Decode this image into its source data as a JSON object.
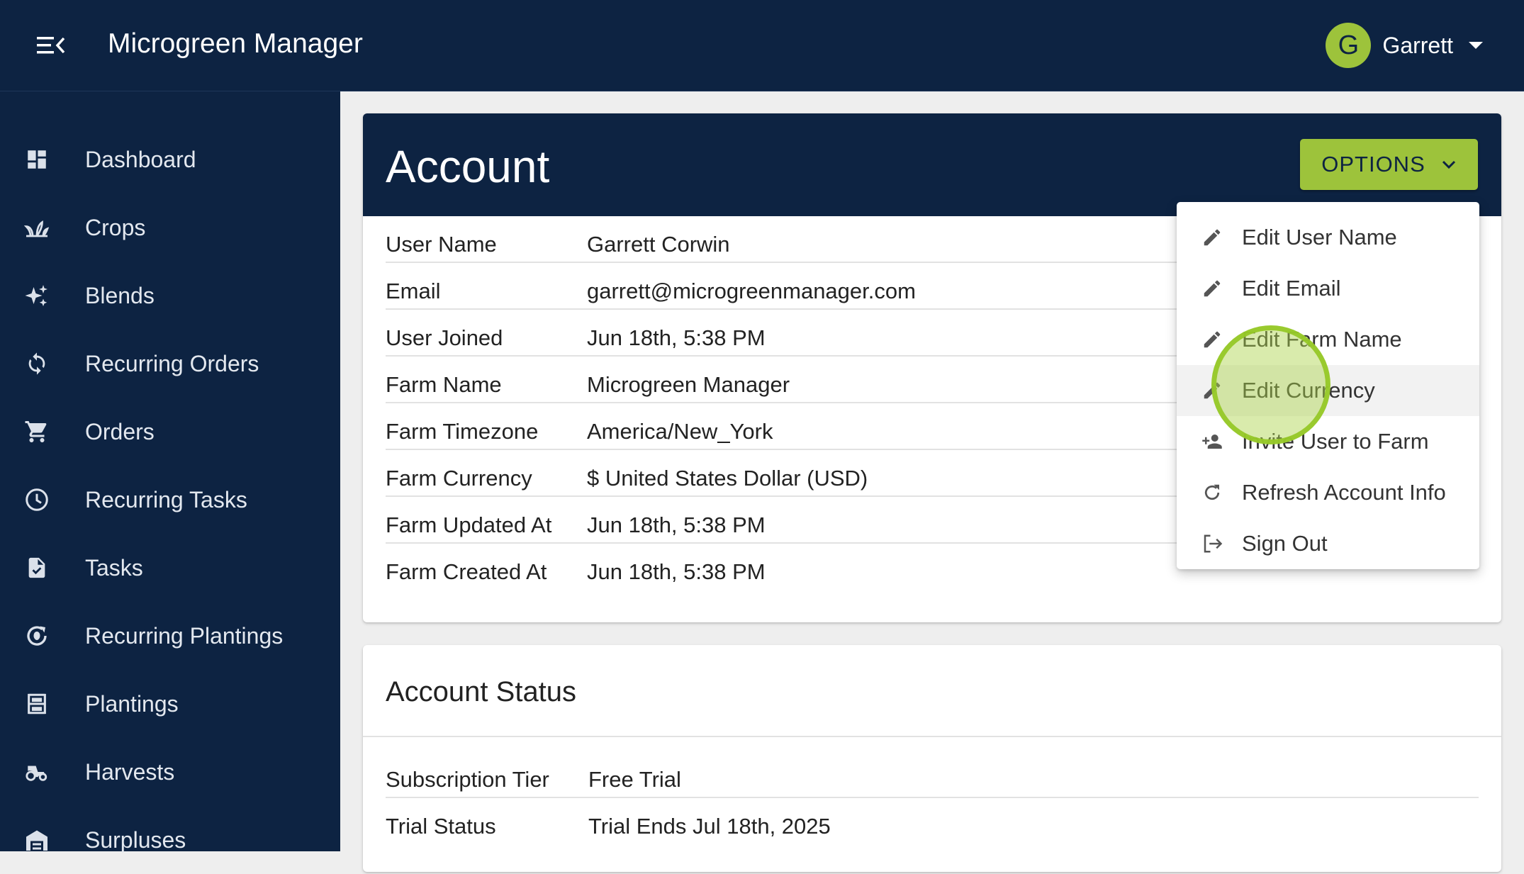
{
  "app": {
    "title": "Microgreen Manager",
    "user_initial": "G",
    "user_name": "Garrett"
  },
  "colors": {
    "navy": "#0d2342",
    "accent_green": "#9dc33b"
  },
  "sidebar": {
    "items": [
      {
        "label": "Dashboard",
        "icon": "dashboard-icon"
      },
      {
        "label": "Crops",
        "icon": "sprout-icon"
      },
      {
        "label": "Blends",
        "icon": "sparkle-icon"
      },
      {
        "label": "Recurring Orders",
        "icon": "repeat-icon"
      },
      {
        "label": "Orders",
        "icon": "cart-icon"
      },
      {
        "label": "Recurring Tasks",
        "icon": "clock-icon"
      },
      {
        "label": "Tasks",
        "icon": "task-file-icon"
      },
      {
        "label": "Recurring Plantings",
        "icon": "seed-cycle-icon"
      },
      {
        "label": "Plantings",
        "icon": "rack-icon"
      },
      {
        "label": "Harvests",
        "icon": "tractor-icon"
      },
      {
        "label": "Surpluses",
        "icon": "warehouse-icon"
      }
    ]
  },
  "account": {
    "title": "Account",
    "options_label": "OPTIONS",
    "rows": [
      {
        "label": "User Name",
        "value": "Garrett Corwin"
      },
      {
        "label": "Email",
        "value": "garrett@microgreenmanager.com"
      },
      {
        "label": "User Joined",
        "value": "Jun 18th, 5:38 PM"
      },
      {
        "label": "Farm Name",
        "value": "Microgreen Manager"
      },
      {
        "label": "Farm Timezone",
        "value": "America/New_York"
      },
      {
        "label": "Farm Currency",
        "value": "$ United States Dollar (USD)"
      },
      {
        "label": "Farm Updated At",
        "value": "Jun 18th, 5:38 PM"
      },
      {
        "label": "Farm Created At",
        "value": "Jun 18th, 5:38 PM"
      }
    ]
  },
  "options_menu": {
    "items": [
      {
        "label": "Edit User Name",
        "icon": "pencil-icon"
      },
      {
        "label": "Edit Email",
        "icon": "pencil-icon"
      },
      {
        "label": "Edit Farm Name",
        "icon": "pencil-icon"
      },
      {
        "label": "Edit Currency",
        "icon": "pencil-icon",
        "hovered": true
      },
      {
        "label": "Invite User to Farm",
        "icon": "add-user-icon"
      },
      {
        "label": "Refresh Account Info",
        "icon": "refresh-icon"
      },
      {
        "label": "Sign Out",
        "icon": "sign-out-icon"
      }
    ]
  },
  "account_status": {
    "title": "Account Status",
    "rows": [
      {
        "label": "Subscription Tier",
        "value": "Free Trial"
      },
      {
        "label": "Trial Status",
        "value": "Trial Ends Jul 18th, 2025"
      }
    ]
  }
}
